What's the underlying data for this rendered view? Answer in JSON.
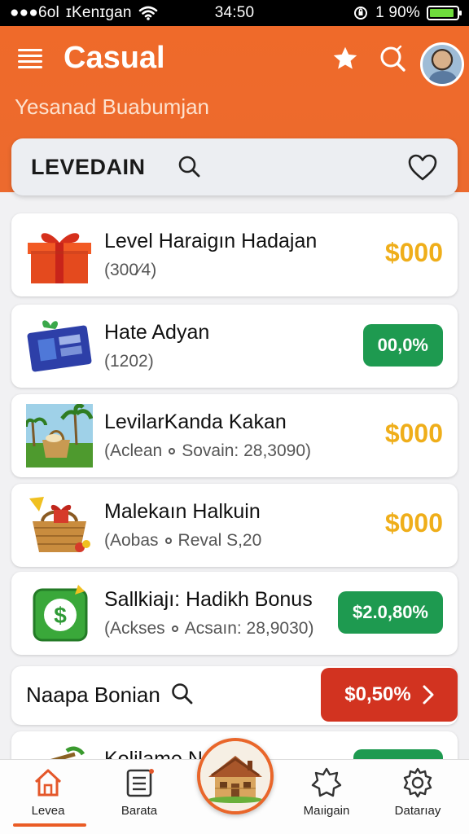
{
  "status_bar": {
    "carrier": "ɪKenɪgan",
    "carrier_prefix": "●●●6ol",
    "time": "34:50",
    "battery_text": "1 90%",
    "battery_level": 0.9
  },
  "header": {
    "title": "Casual",
    "subtitle": "Yesanad Buabumjan"
  },
  "search": {
    "label": "LEVEDAIN"
  },
  "items": [
    {
      "title": "Level Haraigın Hadajan",
      "sub_a": "(300⁄4)",
      "sub_b": "",
      "value": "$000",
      "value_style": "price",
      "thumb": "gift-box-icon"
    },
    {
      "title": "Hate Adyan",
      "sub_a": "(1202)",
      "sub_b": "",
      "value": "00,0%",
      "value_style": "pill",
      "thumb": "gift-card-icon"
    },
    {
      "title": "LevilarKanda Kakan",
      "sub_a": "(Aclean",
      "sub_b": "Sovain: 28,3090)",
      "value": "$000",
      "value_style": "price",
      "thumb": "picnic-basket-icon"
    },
    {
      "title": "Malekaın Halkuin",
      "sub_a": "(Aobas",
      "sub_b": "Reval S,20",
      "value": "$000",
      "value_style": "price",
      "thumb": "gift-basket-icon"
    },
    {
      "title": "Sallkiajı: Hadikh Bonus",
      "sub_a": "(Ackses",
      "sub_b": "Acsaın: 28,9030)",
      "value": "$2.0,80%",
      "value_style": "pill",
      "thumb": "dollar-icon"
    }
  ],
  "bonus": {
    "title": "Naapa Bonian",
    "button_label": "$0,50%"
  },
  "peek": {
    "title": "Kolilame N"
  },
  "nav": {
    "home": "Levea",
    "list": "Barata",
    "map": "Maıigain",
    "settings": "Datarıay"
  },
  "colors": {
    "brand_orange": "#ec6a2e",
    "price_gold": "#efae1a",
    "pill_green": "#1e9a50",
    "bonus_red": "#d23320"
  }
}
